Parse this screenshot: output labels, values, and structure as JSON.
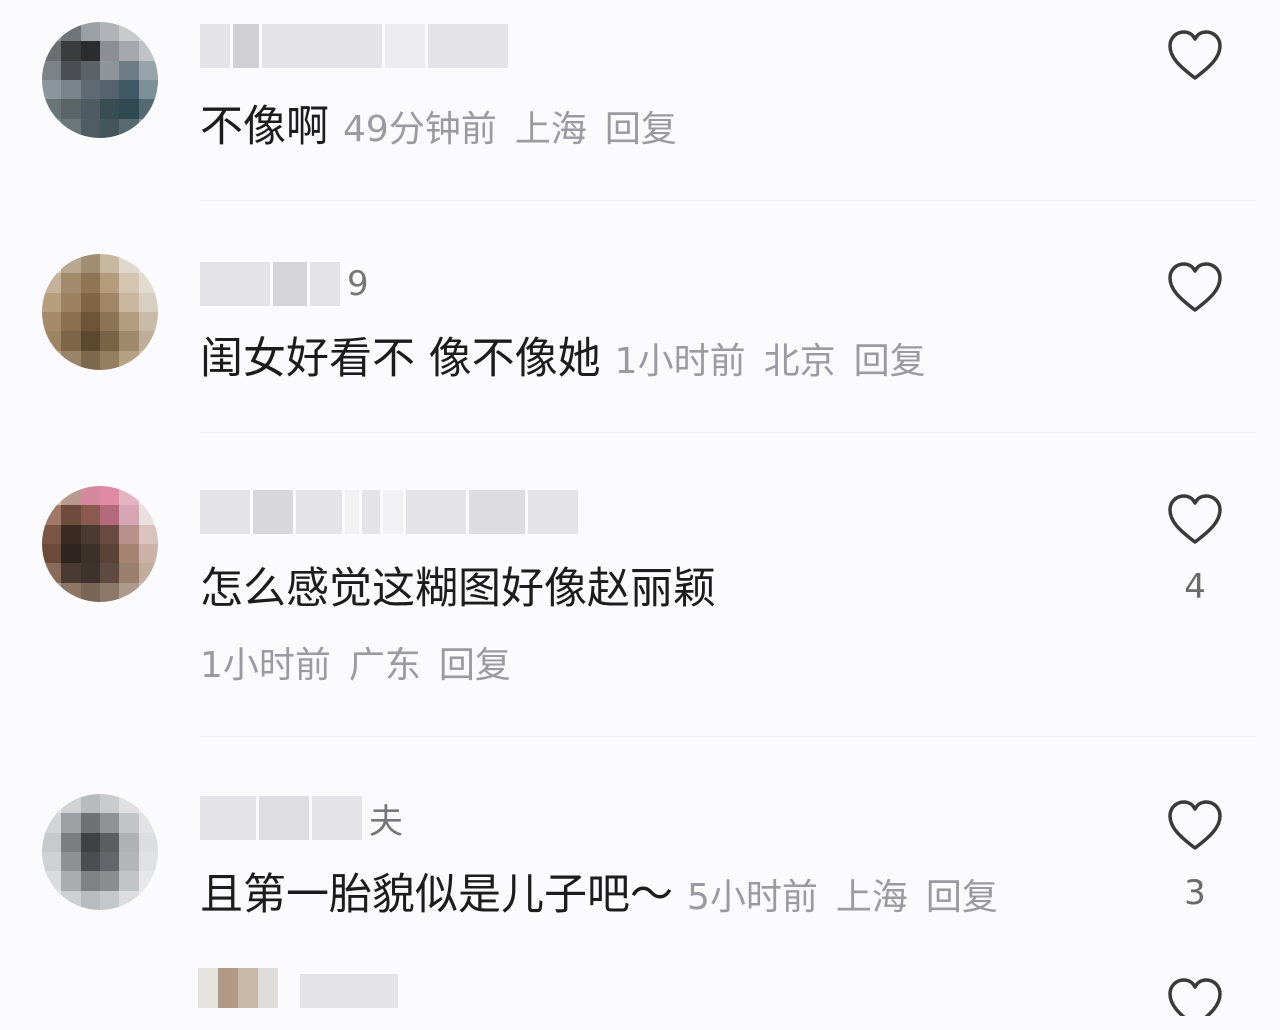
{
  "comments": [
    {
      "username_visible_tail": "",
      "text": "不像啊",
      "time": "49分钟前",
      "location": "上海",
      "reply_label": "回复",
      "like_count": "",
      "icon": "heart-outline-icon",
      "avatar_colors": [
        "#8a8f96",
        "#6f747a",
        "#9aa0a6",
        "#b0b4b8",
        "#c8cace",
        "#d6d8da",
        "#6a6e72",
        "#3a3d40",
        "#2a2c2f",
        "#8b8f93",
        "#a5a9ad",
        "#c0c3c6",
        "#7d8286",
        "#4b4f53",
        "#5d6266",
        "#90959a",
        "#6e7c86",
        "#98a4ac",
        "#8c969c",
        "#7a848a",
        "#5f6a72",
        "#56636c",
        "#3f5a66",
        "#7a8f96",
        "#6a757a",
        "#5a6469",
        "#4e5c61",
        "#3a4d52",
        "#2e4a50",
        "#536b70",
        "#7b8589",
        "#6b767b",
        "#4f5d62",
        "#42565b",
        "#566a70",
        "#8a9a9f"
      ]
    },
    {
      "username_visible_tail": "9",
      "text": "闺女好看不 像不像她",
      "time": "1小时前",
      "location": "北京",
      "reply_label": "回复",
      "like_count": "",
      "icon": "heart-outline-icon",
      "avatar_colors": [
        "#d9d6d2",
        "#b8a890",
        "#a08d72",
        "#c7b79f",
        "#e0d8cc",
        "#ebe6df",
        "#c4b39a",
        "#a28b6c",
        "#8f7556",
        "#b39b7c",
        "#d3c5b0",
        "#e2dbd0",
        "#b79f7e",
        "#9c8262",
        "#7f6446",
        "#a08566",
        "#c8b79e",
        "#d9cfc0",
        "#a48a6a",
        "#8a6f50",
        "#6e5538",
        "#8d7454",
        "#b29d80",
        "#c9bba7",
        "#9d8465",
        "#7e6548",
        "#5c472f",
        "#7a6246",
        "#a08a6e",
        "#bfae97",
        "#b6a386",
        "#9a8468",
        "#7d684e",
        "#947e62",
        "#b4a184",
        "#cbbca6"
      ]
    },
    {
      "username_visible_tail": "",
      "text": "怎么感觉这糊图好像赵丽颖",
      "time": "1小时前",
      "location": "广东",
      "reply_label": "回复",
      "like_count": "4",
      "icon": "heart-outline-icon",
      "avatar_colors": [
        "#cfc2b8",
        "#b99a8e",
        "#d48a9c",
        "#e08aa6",
        "#e6b3c3",
        "#efe6e6",
        "#a07868",
        "#6e4c3c",
        "#8a5a50",
        "#b46a7a",
        "#d6a6b4",
        "#e9dfdf",
        "#7a5444",
        "#3a2a22",
        "#4a3a30",
        "#6a4a40",
        "#b8928a",
        "#d8c4bc",
        "#6c4a3a",
        "#2e2420",
        "#3c302a",
        "#5a4238",
        "#a68272",
        "#cbb2a4",
        "#8a6a58",
        "#4a3a32",
        "#3e322c",
        "#5e4a40",
        "#9a7e6e",
        "#c2ac9e",
        "#b49a88",
        "#8e7664",
        "#7a6656",
        "#8c7868",
        "#ae9a8a",
        "#d2c4b8"
      ]
    },
    {
      "username_visible_tail": "夫",
      "text": "且第一胎貌似是儿子吧～",
      "time": "5小时前",
      "location": "上海",
      "reply_label": "回复",
      "like_count": "3",
      "icon": "heart-outline-icon",
      "avatar_colors": [
        "#e3e4e6",
        "#d0d2d4",
        "#b8bbbe",
        "#c9cbcd",
        "#dfe0e2",
        "#eceded",
        "#d2d4d6",
        "#9da1a4",
        "#6e7275",
        "#8e9295",
        "#c3c6c8",
        "#e2e3e4",
        "#c7cacc",
        "#7a7e81",
        "#3e4245",
        "#5a5e61",
        "#aeb2b4",
        "#dcdddf",
        "#cfd2d4",
        "#8d9194",
        "#4a4e51",
        "#62666a",
        "#b2b6b8",
        "#e0e1e3",
        "#dadcdd",
        "#a9adaf",
        "#7e8285",
        "#8a8e91",
        "#c2c5c7",
        "#e6e7e8",
        "#e3e4e5",
        "#cdd0d2",
        "#b9bcbe",
        "#c5c8ca",
        "#dcdddf",
        "#eeeeef"
      ]
    }
  ],
  "partial_comment": {
    "icon": "heart-outline-icon"
  }
}
